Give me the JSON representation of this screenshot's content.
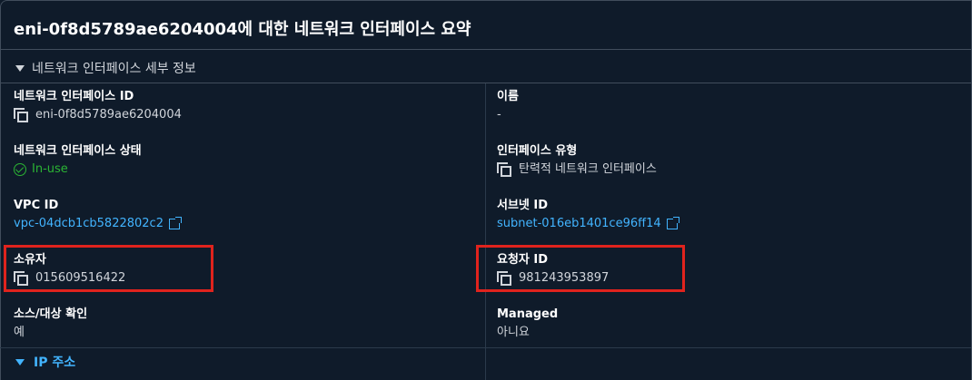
{
  "title": "eni-0f8d5789ae6204004에 대한 네트워크 인터페이스 요약",
  "section": {
    "header": "네트워크 인터페이스 세부 정보"
  },
  "fields": {
    "eni_id": {
      "label": "네트워크 인터페이스 ID",
      "value": "eni-0f8d5789ae6204004"
    },
    "name": {
      "label": "이름",
      "value": "-"
    },
    "state": {
      "label": "네트워크 인터페이스 상태",
      "value": "In-use"
    },
    "interface_type": {
      "label": "인터페이스 유형",
      "value": "탄력적 네트워크 인터페이스"
    },
    "vpc_id": {
      "label": "VPC ID",
      "value": "vpc-04dcb1cb5822802c2"
    },
    "subnet_id": {
      "label": "서브넷 ID",
      "value": "subnet-016eb1401ce96ff14"
    },
    "owner": {
      "label": "소유자",
      "value": "015609516422"
    },
    "requester_id": {
      "label": "요청자 ID",
      "value": "981243953897"
    },
    "source_dest_check": {
      "label": "소스/대상 확인",
      "value": "예"
    },
    "managed": {
      "label": "Managed",
      "value": "아니요"
    }
  },
  "ip_section": {
    "header": "IP 주소"
  },
  "colors": {
    "background": "#0f1b2a",
    "link": "#42b4ff",
    "success": "#2bb534",
    "highlight": "#e0231d"
  },
  "icons": {
    "copy": "copy-icon",
    "status": "check-circle-icon",
    "external": "external-link-icon",
    "expand": "caret-down-icon"
  }
}
